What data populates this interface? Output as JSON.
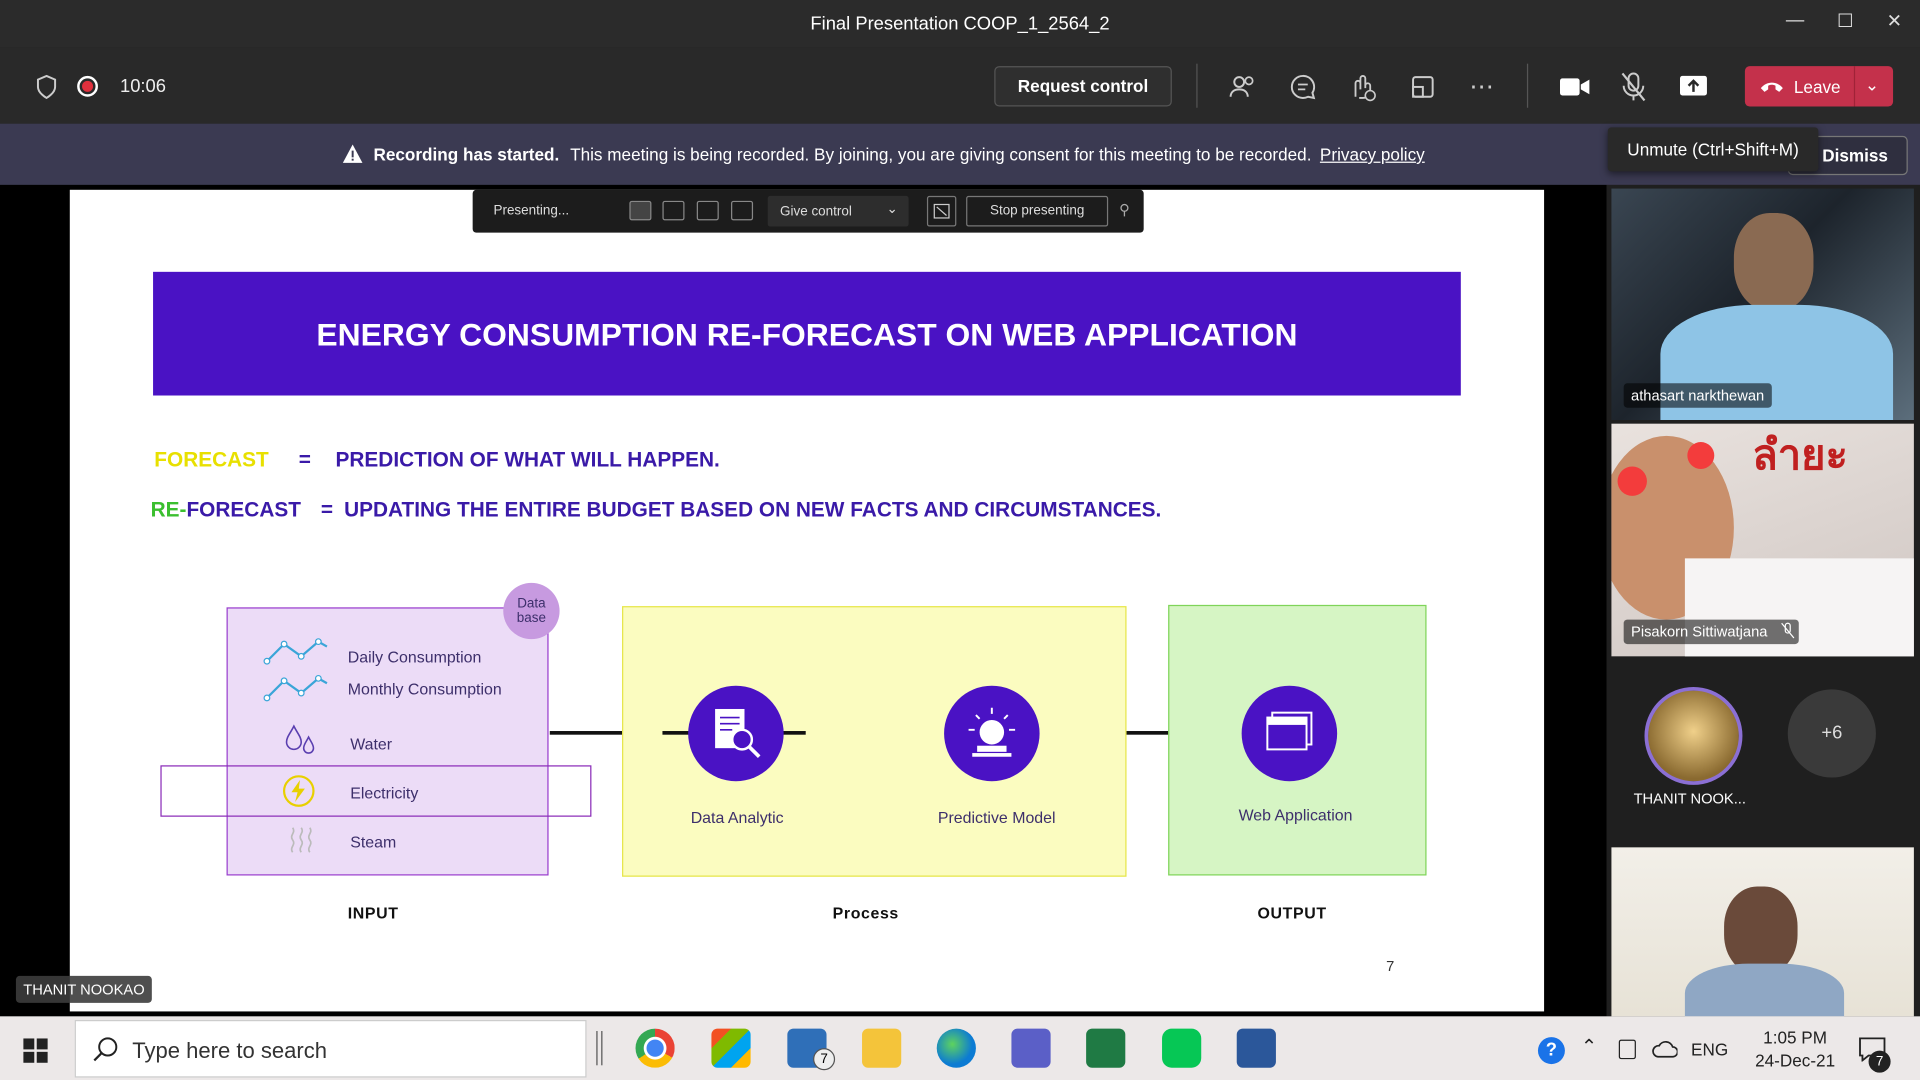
{
  "window": {
    "title": "Final Presentation COOP_1_2564_2"
  },
  "meeting": {
    "time": "10:06",
    "request_control": "Request control",
    "leave_label": "Leave",
    "tooltip": "Unmute (Ctrl+Shift+M)"
  },
  "banner": {
    "bold": "Recording has started.",
    "text": "This meeting is being recorded. By joining, you are giving consent for this meeting to be recorded.",
    "link": "Privacy policy",
    "dismiss": "Dismiss"
  },
  "presenter_bar": {
    "status": "Presenting...",
    "give_control": "Give control",
    "stop": "Stop presenting"
  },
  "slide": {
    "title": "ENERGY CONSUMPTION RE-FORECAST ON WEB APPLICATION",
    "def1_term": "FORECAST",
    "def1_eq": "=",
    "def1_text": "PREDICTION OF WHAT WILL HAPPEN.",
    "def2_term_re": "RE-",
    "def2_term_rest": "FORECAST",
    "def2_eq": "=",
    "def2_text": "UPDATING THE ENTIRE BUDGET BASED ON NEW  FACTS AND CIRCUMSTANCES.",
    "database_badge_1": "Data",
    "database_badge_2": "base",
    "inputs": [
      "Daily Consumption",
      "Monthly Consumption",
      "Water",
      "Electricity",
      "Steam"
    ],
    "process_1": "Data Analytic",
    "process_2": "Predictive Model",
    "output": "Web Application",
    "col_input": "INPUT",
    "col_process": "Process",
    "col_output": "OUTPUT",
    "page_number": "7"
  },
  "stage_name": "THANIT NOOKAO",
  "participants": {
    "p1": "athasart narkthewan",
    "p2": "Pisakorn Sittiwatjana",
    "p3": "THANIT NOOK...",
    "more": "+6",
    "p2_overlay": "ลำยะ"
  },
  "taskbar": {
    "search_placeholder": "Type here to search",
    "lang": "ENG",
    "time": "1:05 PM",
    "date": "24-Dec-21",
    "mail_badge": "7",
    "notif_badge": "7"
  },
  "colors": {
    "slide_purple": "#4a12c4",
    "forecast_yellow": "#e8e000",
    "re_green": "#3bbf2f",
    "leave_red": "#c4314b"
  }
}
